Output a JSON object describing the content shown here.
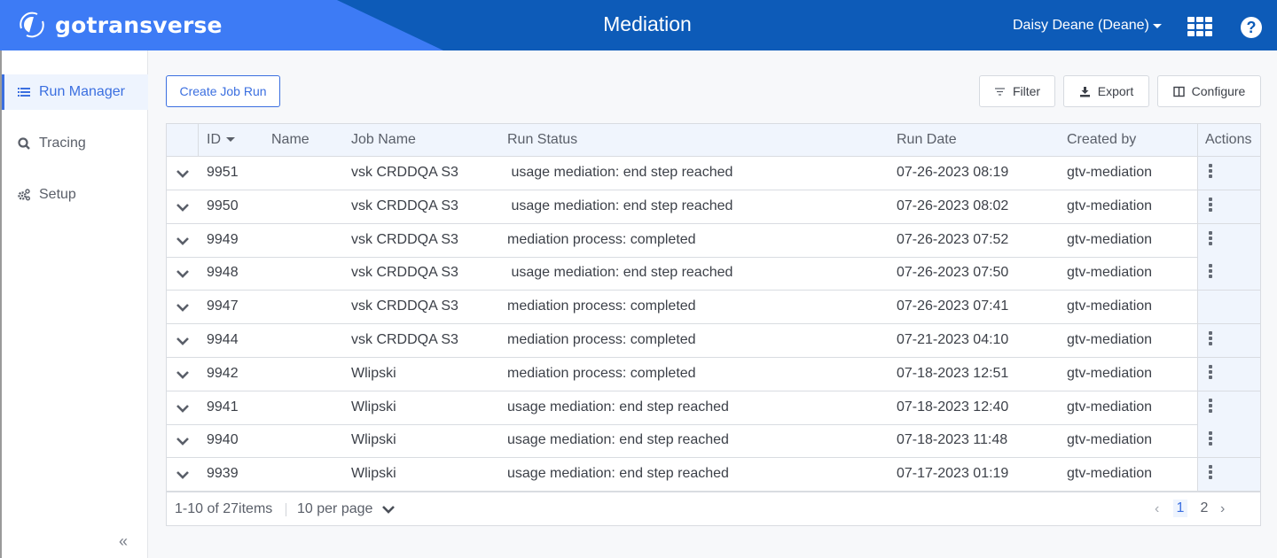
{
  "header": {
    "brand": "gotransverse",
    "title": "Mediation",
    "user": "Daisy Deane (Deane)",
    "colors": {
      "brand_blue": "#3d7bf5",
      "header_blue": "#0d5bb8",
      "accent": "#3b6fe0"
    }
  },
  "sidebar": {
    "items": [
      {
        "label": "Run Manager",
        "icon": "list-icon",
        "active": true
      },
      {
        "label": "Tracing",
        "icon": "search-icon",
        "active": false
      },
      {
        "label": "Setup",
        "icon": "gears-icon",
        "active": false
      }
    ],
    "collapse_glyph": "«"
  },
  "toolbar": {
    "create_label": "Create Job Run",
    "filter_label": "Filter",
    "export_label": "Export",
    "configure_label": "Configure"
  },
  "table": {
    "columns": {
      "id": "ID",
      "name": "Name",
      "job_name": "Job Name",
      "run_status": "Run Status",
      "run_date": "Run Date",
      "created_by": "Created by",
      "actions": "Actions"
    },
    "rows": [
      {
        "id": "9951",
        "name": "",
        "job_name": "vsk CRDDQA S3",
        "run_status": " usage mediation: end step reached",
        "run_date": "07-26-2023 08:19",
        "created_by": "gtv-mediation",
        "has_actions": true
      },
      {
        "id": "9950",
        "name": "",
        "job_name": "vsk CRDDQA S3",
        "run_status": " usage mediation: end step reached",
        "run_date": "07-26-2023 08:02",
        "created_by": "gtv-mediation",
        "has_actions": true
      },
      {
        "id": "9949",
        "name": "",
        "job_name": "vsk CRDDQA S3",
        "run_status": "mediation process: completed",
        "run_date": "07-26-2023 07:52",
        "created_by": "gtv-mediation",
        "has_actions": true
      },
      {
        "id": "9948",
        "name": "",
        "job_name": "vsk CRDDQA S3",
        "run_status": " usage mediation: end step reached",
        "run_date": "07-26-2023 07:50",
        "created_by": "gtv-mediation",
        "has_actions": true
      },
      {
        "id": "9947",
        "name": "",
        "job_name": "vsk CRDDQA S3",
        "run_status": "mediation process: completed",
        "run_date": "07-26-2023 07:41",
        "created_by": "gtv-mediation",
        "has_actions": false
      },
      {
        "id": "9944",
        "name": "",
        "job_name": "vsk CRDDQA S3",
        "run_status": "mediation process: completed",
        "run_date": "07-21-2023 04:10",
        "created_by": "gtv-mediation",
        "has_actions": true
      },
      {
        "id": "9942",
        "name": "",
        "job_name": "Wlipski",
        "run_status": "mediation process: completed",
        "run_date": "07-18-2023 12:51",
        "created_by": "gtv-mediation",
        "has_actions": true
      },
      {
        "id": "9941",
        "name": "",
        "job_name": "Wlipski",
        "run_status": "usage mediation: end step reached",
        "run_date": "07-18-2023 12:40",
        "created_by": "gtv-mediation",
        "has_actions": true
      },
      {
        "id": "9940",
        "name": "",
        "job_name": "Wlipski",
        "run_status": "usage mediation: end step reached",
        "run_date": "07-18-2023 11:48",
        "created_by": "gtv-mediation",
        "has_actions": true
      },
      {
        "id": "9939",
        "name": "",
        "job_name": "Wlipski",
        "run_status": "usage mediation: end step reached",
        "run_date": "07-17-2023 01:19",
        "created_by": "gtv-mediation",
        "has_actions": true
      }
    ]
  },
  "pager": {
    "info": "1-10 of 27items",
    "per_page": "10 per page",
    "prev": "‹",
    "next": "›",
    "pages": [
      "1",
      "2"
    ],
    "current_page": "1"
  }
}
